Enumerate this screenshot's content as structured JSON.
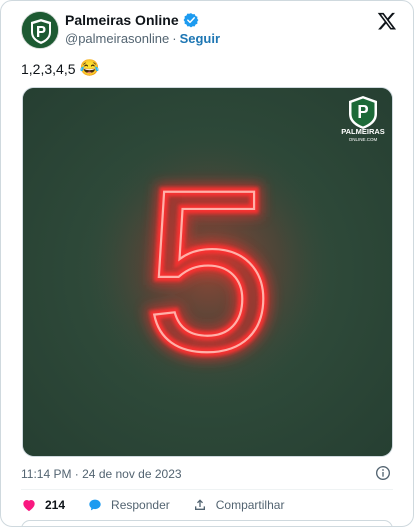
{
  "author": {
    "name": "Palmeiras Online",
    "handle": "@palmeirasonline",
    "separator": "·",
    "follow_label": "Seguir"
  },
  "tweet": {
    "text": "1,2,3,4,5",
    "emoji": "😂"
  },
  "media": {
    "neon_number": "5",
    "brand_name": "PALMEIRAS",
    "brand_sub": "ONLINE.COM"
  },
  "meta": {
    "timestamp": "11:14 PM · 24 de nov de 2023"
  },
  "actions": {
    "likes_count": "214",
    "reply_label": "Responder",
    "share_label": "Compartilhar"
  },
  "colors": {
    "brand_green": "#1d5a32",
    "media_background": "#2e4a3d",
    "neon_red": "#ff2a2a",
    "like_pink": "#f91880",
    "link_blue": "#1d76b3",
    "verified_blue": "#1d9bf0"
  },
  "icons": [
    "palmeiras-crest-icon",
    "verified-badge-icon",
    "x-logo-icon",
    "info-icon",
    "heart-icon",
    "reply-bubble-icon",
    "share-icon"
  ]
}
